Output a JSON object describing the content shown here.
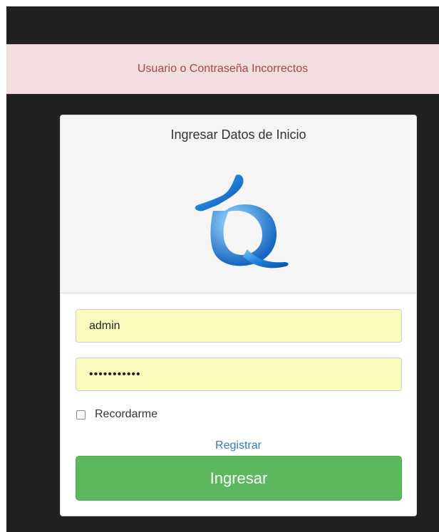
{
  "alert": {
    "message": "Usuario o Contraseña Incorrectos",
    "color": "#a94442",
    "background": "#f2dede"
  },
  "login": {
    "title": "Ingresar Datos de Inicio",
    "logo_icon": "q-logo-icon",
    "username_value": "admin",
    "password_value": "•••••••••••",
    "remember_label": "Recordarme",
    "remember_checked": false,
    "register_link": "Registrar",
    "submit_label": "Ingresar",
    "submit_color": "#5cb85c",
    "input_background": "#fafcbd"
  }
}
